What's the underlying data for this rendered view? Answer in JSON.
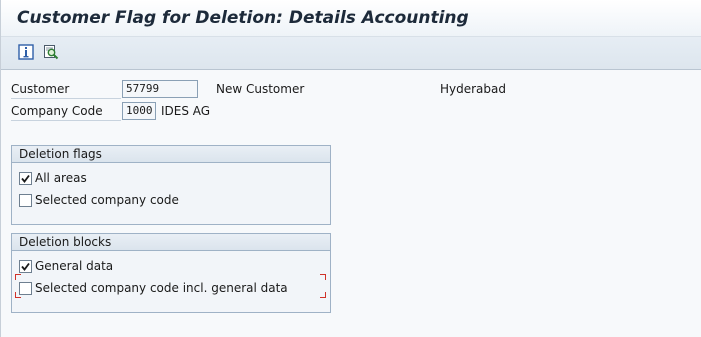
{
  "window": {
    "title": "Customer Flag for Deletion: Details Accounting"
  },
  "toolbar": {
    "buttons": [
      {
        "icon": "info-icon"
      },
      {
        "icon": "find-document-icon"
      }
    ]
  },
  "header_fields": {
    "customer": {
      "label": "Customer",
      "value": "57799",
      "name": "New Customer",
      "city": "Hyderabad"
    },
    "company_code": {
      "label": "Company Code",
      "value": "1000",
      "name": "IDES AG"
    }
  },
  "deletion_flags": {
    "title": "Deletion flags",
    "items": [
      {
        "label": "All areas",
        "checked": true
      },
      {
        "label": "Selected company code",
        "checked": false
      }
    ]
  },
  "deletion_blocks": {
    "title": "Deletion blocks",
    "items": [
      {
        "label": "General data",
        "checked": true
      },
      {
        "label": "Selected company code incl. general data",
        "checked": false,
        "focused": true
      }
    ]
  },
  "colors": {
    "focus_marker": "#d0322a",
    "group_border": "#9fb2c6",
    "toolbar_bg": "#dde6ee"
  }
}
